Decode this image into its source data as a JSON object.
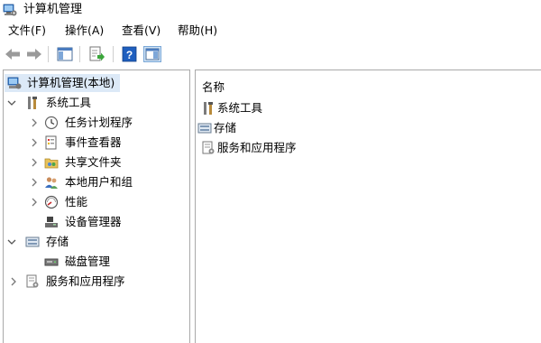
{
  "window": {
    "title": "计算机管理"
  },
  "menu": {
    "items": [
      "文件(F)",
      "操作(A)",
      "查看(V)",
      "帮助(H)"
    ]
  },
  "tree": {
    "root": "计算机管理(本地)",
    "system_tools": {
      "label": "系统工具",
      "children": [
        "任务计划程序",
        "事件查看器",
        "共享文件夹",
        "本地用户和组",
        "性能",
        "设备管理器"
      ]
    },
    "storage": {
      "label": "存储",
      "children": [
        "磁盘管理"
      ]
    },
    "services": {
      "label": "服务和应用程序"
    }
  },
  "list": {
    "column_header": "名称",
    "rows": [
      "系统工具",
      "存储",
      "服务和应用程序"
    ]
  },
  "icons": {
    "window": "computer-management-icon",
    "back": "back-arrow-icon",
    "forward": "forward-arrow-icon",
    "console_tree": "show-hide-console-tree-icon",
    "export": "export-list-icon",
    "help": "help-icon",
    "action_pane": "show-hide-action-pane-icon"
  },
  "colors": {
    "selection": "#dce9f7",
    "border": "#a9a9a9",
    "help_blue": "#1f5fbf"
  }
}
